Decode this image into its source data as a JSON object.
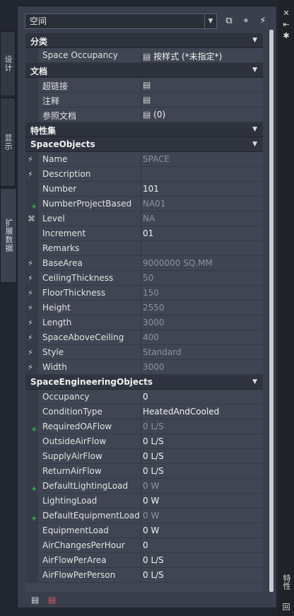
{
  "combo": {
    "value": "空间"
  },
  "tabs": {
    "design": "设计",
    "display": "显示",
    "extended": "扩展数据"
  },
  "side_title": "特性",
  "side_box": "回",
  "sections": {
    "category": "分类",
    "documents": "文档",
    "property_sets": "特性集"
  },
  "category_rows": [
    {
      "name": "Space Occupancy",
      "value": "按样式 (*未指定*)"
    }
  ],
  "document_rows": [
    {
      "name": "超链接",
      "value": ""
    },
    {
      "name": "注释",
      "value": ""
    },
    {
      "name": "参照文档",
      "value": "(0)"
    }
  ],
  "space_objects": {
    "title": "SpaceObjects",
    "rows": [
      {
        "name": "Name",
        "value": "SPACE",
        "dim": true,
        "icon": "lightning"
      },
      {
        "name": "Description",
        "value": "",
        "dim": false,
        "icon": "lightning"
      },
      {
        "name": "Number",
        "value": "101",
        "dim": false,
        "icon": ""
      },
      {
        "name": "NumberProjectBased",
        "value": "NA01",
        "dim": true,
        "icon": "plus"
      },
      {
        "name": "Level",
        "value": "NA",
        "dim": true,
        "icon": "satellite"
      },
      {
        "name": "Increment",
        "value": "01",
        "dim": false,
        "icon": ""
      },
      {
        "name": "Remarks",
        "value": "",
        "dim": false,
        "icon": ""
      },
      {
        "name": "BaseArea",
        "value": "9000000 SQ.MM",
        "dim": true,
        "icon": "lightning"
      },
      {
        "name": "CeilingThickness",
        "value": "50",
        "dim": true,
        "icon": "lightning"
      },
      {
        "name": "FloorThickness",
        "value": "150",
        "dim": true,
        "icon": "lightning"
      },
      {
        "name": "Height",
        "value": "2550",
        "dim": true,
        "icon": "lightning"
      },
      {
        "name": "Length",
        "value": "3000",
        "dim": true,
        "icon": "lightning"
      },
      {
        "name": "SpaceAboveCeiling",
        "value": "400",
        "dim": true,
        "icon": "lightning"
      },
      {
        "name": "Style",
        "value": "Standard",
        "dim": true,
        "icon": "lightning"
      },
      {
        "name": "Width",
        "value": "3000",
        "dim": true,
        "icon": "lightning"
      }
    ]
  },
  "space_engineering": {
    "title": "SpaceEngineeringObjects",
    "rows": [
      {
        "name": "Occupancy",
        "value": "0",
        "dim": false,
        "icon": ""
      },
      {
        "name": "ConditionType",
        "value": "HeatedAndCooled",
        "dim": false,
        "icon": ""
      },
      {
        "name": "RequiredOAFlow",
        "value": "0 L/S",
        "dim": true,
        "icon": "plus"
      },
      {
        "name": "OutsideAirFlow",
        "value": "0 L/S",
        "dim": false,
        "icon": ""
      },
      {
        "name": "SupplyAirFlow",
        "value": "0 L/S",
        "dim": false,
        "icon": ""
      },
      {
        "name": "ReturnAirFlow",
        "value": "0 L/S",
        "dim": false,
        "icon": ""
      },
      {
        "name": "DefaultLightingLoad",
        "value": "0 W",
        "dim": true,
        "icon": "plus"
      },
      {
        "name": "LightingLoad",
        "value": "0 W",
        "dim": false,
        "icon": ""
      },
      {
        "name": "DefaultEquipmentLoad",
        "value": "0 W",
        "dim": true,
        "icon": "plus"
      },
      {
        "name": "EquipmentLoad",
        "value": "0 W",
        "dim": false,
        "icon": ""
      },
      {
        "name": "AirChangesPerHour",
        "value": "0",
        "dim": false,
        "icon": ""
      },
      {
        "name": "AirFlowPerArea",
        "value": "0 L/S",
        "dim": false,
        "icon": ""
      },
      {
        "name": "AirFlowPerPerson",
        "value": "0 L/S",
        "dim": false,
        "icon": ""
      }
    ]
  },
  "icons": {
    "select_objects": "select-objects-icon",
    "pick_add": "pick-add-icon",
    "quick_select": "quick-select-icon",
    "close": "close-icon",
    "autohide": "auto-hide-icon",
    "settings": "settings-icon",
    "add_property_set": "add-property-set-icon",
    "remove_property_set": "remove-property-set-icon"
  }
}
